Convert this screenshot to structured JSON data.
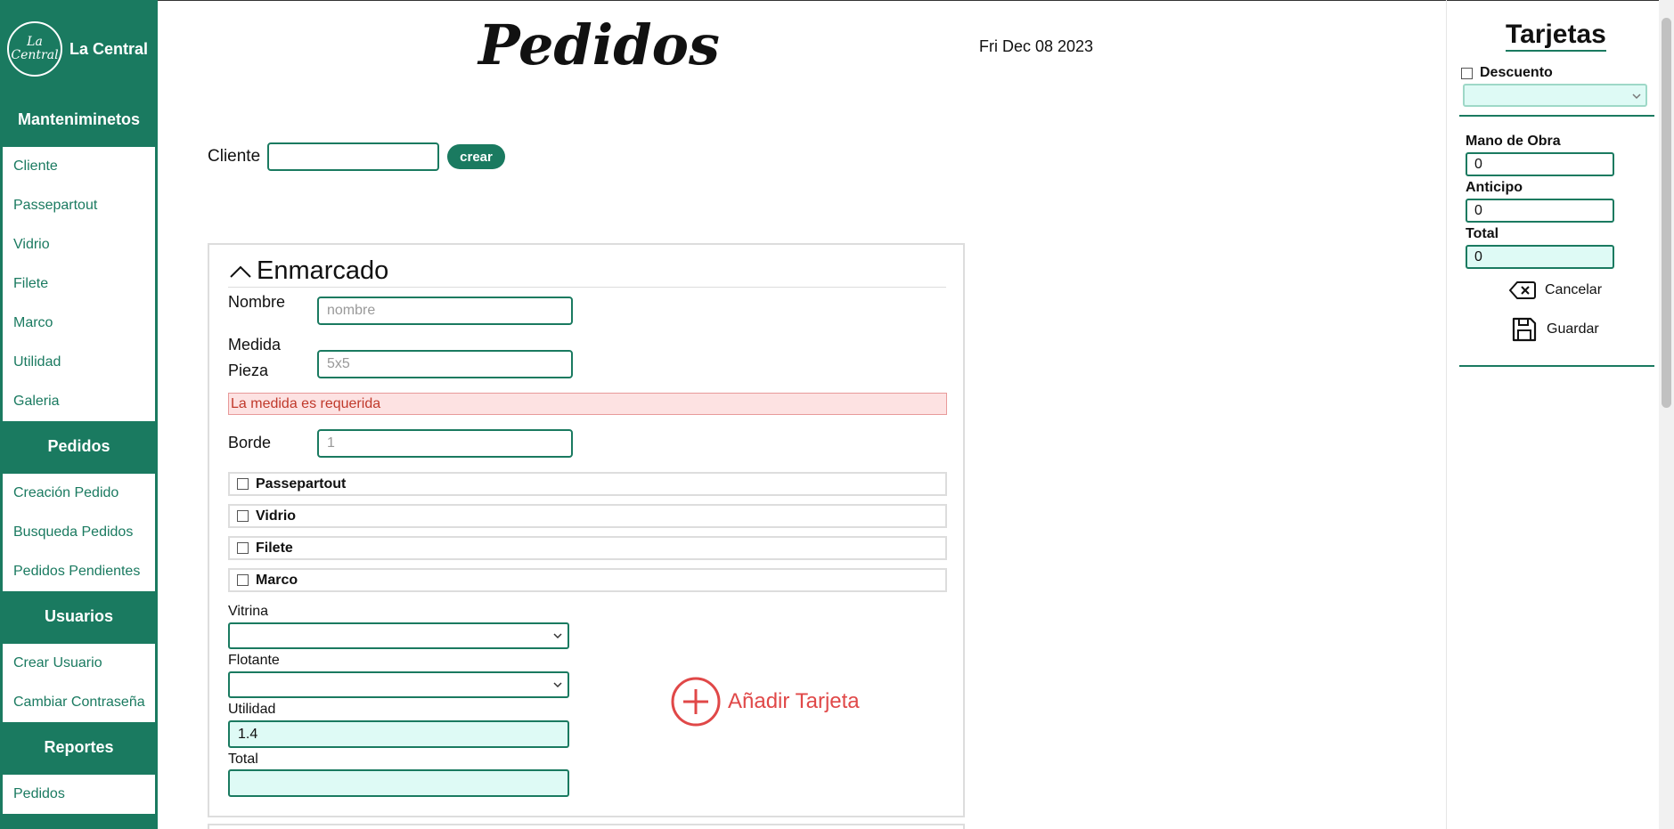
{
  "brand": {
    "logo_line1": "La",
    "logo_line2": "Central",
    "name": "La Central"
  },
  "sidebar": {
    "sections": [
      {
        "title": "Manteniminetos",
        "items": [
          "Cliente",
          "Passepartout",
          "Vidrio",
          "Filete",
          "Marco",
          "Utilidad",
          "Galeria"
        ]
      },
      {
        "title": "Pedidos",
        "items": [
          "Creación Pedido",
          "Busqueda Pedidos",
          "Pedidos Pendientes"
        ]
      },
      {
        "title": "Usuarios",
        "items": [
          "Crear Usuario",
          "Cambiar Contraseña"
        ]
      },
      {
        "title": "Reportes",
        "items": [
          "Pedidos"
        ]
      }
    ]
  },
  "header": {
    "title": "Pedidos",
    "date": "Fri Dec 08 2023"
  },
  "cliente": {
    "label": "Cliente",
    "value": "",
    "create_label": "crear"
  },
  "card": {
    "title": "Enmarcado",
    "nombre_label": "Nombre",
    "nombre_placeholder": "nombre",
    "medida_label_1": "Medida",
    "medida_label_2": "Pieza",
    "medida_placeholder": "5x5",
    "medida_error": "La medida es requerida",
    "borde_label": "Borde",
    "borde_placeholder": "1",
    "options": [
      "Passepartout",
      "Vidrio",
      "Filete",
      "Marco"
    ],
    "vitrina_label": "Vitrina",
    "flotante_label": "Flotante",
    "utilidad_label": "Utilidad",
    "utilidad_value": "1.4",
    "total_label": "Total",
    "total_value": "",
    "add_label": "Añadir Tarjeta"
  },
  "panel": {
    "title": "Tarjetas",
    "descuento_label": "Descuento",
    "mano_label": "Mano de Obra",
    "mano_value": "0",
    "anticipo_label": "Anticipo",
    "anticipo_value": "0",
    "total_label": "Total",
    "total_value": "0",
    "cancel_label": "Cancelar",
    "save_label": "Guardar"
  },
  "colors": {
    "brand": "#1a7a60",
    "error": "#e04848",
    "readonly_bg": "#defaf5"
  }
}
